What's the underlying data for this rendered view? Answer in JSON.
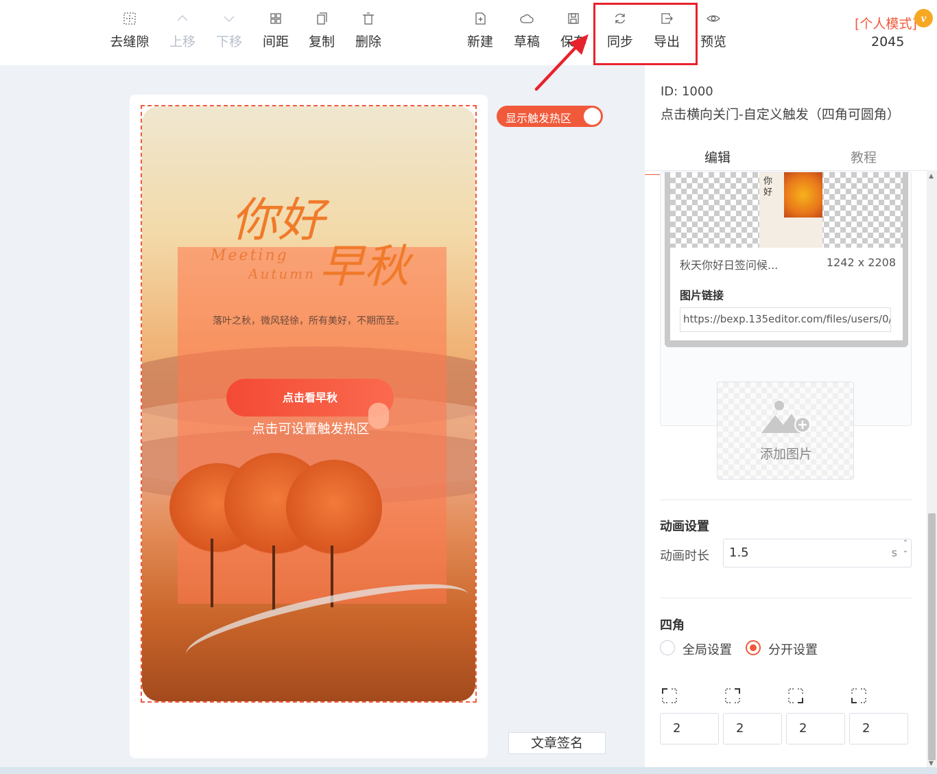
{
  "toolbar": {
    "items": [
      {
        "label": "去缝隙",
        "icon": "grid-dots-icon"
      },
      {
        "label": "上移",
        "icon": "chevron-up-icon"
      },
      {
        "label": "下移",
        "icon": "chevron-down-icon"
      },
      {
        "label": "间距",
        "icon": "spacing-icon"
      },
      {
        "label": "复制",
        "icon": "copy-icon"
      },
      {
        "label": "删除",
        "icon": "trash-icon"
      },
      {
        "label": "新建",
        "icon": "new-file-icon"
      },
      {
        "label": "草稿",
        "icon": "cloud-icon"
      },
      {
        "label": "保存",
        "icon": "save-icon"
      },
      {
        "label": "同步",
        "icon": "sync-icon"
      },
      {
        "label": "导出",
        "icon": "export-icon"
      },
      {
        "label": "预览",
        "icon": "eye-icon"
      }
    ],
    "mode_label": "[个人模式]",
    "mode_badge": "v",
    "user_number": "2045",
    "highlight_color": "#e8222d"
  },
  "canvas": {
    "hotzone_toggle_label": "显示触发热区",
    "hotzone_on": true,
    "signature_button": "文章签名",
    "accent": "#f05a3b"
  },
  "poster": {
    "title_1": "你好",
    "title_2": "早秋",
    "english_1": "Meeting",
    "english_2": "Autumn",
    "subtitle": "落叶之秋，微风轻徐，所有美好，不期而至。",
    "cta_label": "点击看早秋",
    "cta_hint": "点击可设置触发热区"
  },
  "panel": {
    "id_line": "ID: 1000",
    "template_name": "点击横向关门-自定义触发（四角可圆角）",
    "tabs": [
      {
        "label": "编辑",
        "active": true
      },
      {
        "label": "教程",
        "active": false
      }
    ],
    "image": {
      "thumb_text": "你\n好",
      "name": "秋天你好日签问候...",
      "size": "1242 x 2208",
      "link_label": "图片链接",
      "link_value": "https://bexp.135editor.com/files/users/0/"
    },
    "add_image_label": "添加图片",
    "animation": {
      "section_title": "动画设置",
      "duration_label": "动画时长",
      "duration_value": "1.5",
      "duration_unit": "s"
    },
    "corners": {
      "section_title": "四角",
      "options": [
        {
          "label": "全局设置",
          "checked": false
        },
        {
          "label": "分开设置",
          "checked": true
        }
      ],
      "values": [
        "2",
        "2",
        "2",
        "2"
      ]
    }
  }
}
